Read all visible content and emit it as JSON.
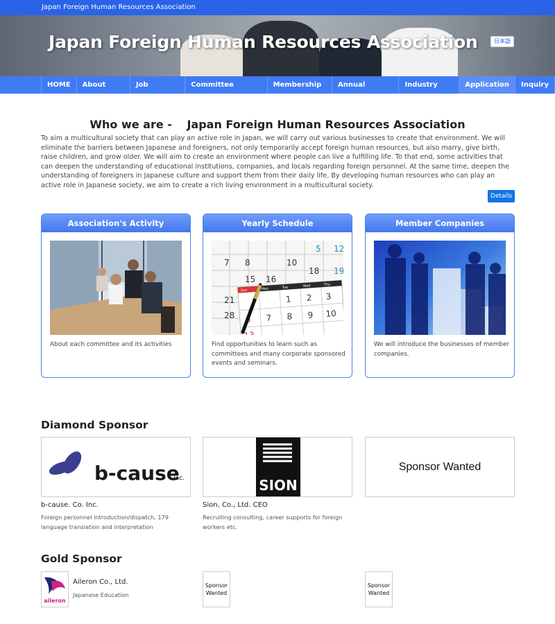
{
  "topbar": {
    "title": "Japan Foreign Human Resources Association"
  },
  "hero": {
    "title": "Japan Foreign Human Resources Association",
    "lang_button": "日本語"
  },
  "nav": {
    "items": [
      "HOME",
      "About JFHRA",
      "Job classified",
      "Committee acitivities",
      "Membership list",
      "Annual Schedule",
      "Industry Event",
      "Application",
      "Inquiry"
    ]
  },
  "intro": {
    "heading": "Who we are -　 Japan Foreign Human Resources Association",
    "text": "To aim a multicultural society that can play an active role in Japan, we will carry out various businesses to create that environment. We will eliminate the barriers between Japanese and foreigners, not only temporarily accept foreign human resources, but also marry, give birth, raise children, and grow older. We will aim to create an environment where people can live a fulfilling life. To that end, some activities that can deepen the understanding of educational institutions, companies, and locals regarding foreign personnel. At the same time, deepen the understanding of foreigners in Japanese culture and support them from their daily life. By developing human resources who can play an active role in Japanese society, we aim to create a rich living environment in a multicultural society.",
    "details_button": "Details"
  },
  "cards": [
    {
      "title": "Association's Activity",
      "text": "About each committee and its activities"
    },
    {
      "title": "Yearly Schedule",
      "text": "Find opportunities to learn such as committees and many corporate sponsored events and seminars."
    },
    {
      "title": "Member Companies",
      "text": "We will introduce the businesses of member companies."
    }
  ],
  "calendar": {
    "back_rows": [
      [
        "",
        "",
        "",
        "",
        "",
        "5",
        "12"
      ],
      [
        "7",
        "8",
        "",
        "10",
        "",
        "",
        "19"
      ],
      [
        "",
        "15",
        "16",
        "",
        "18",
        "",
        ""
      ],
      [
        "21",
        "22",
        "",
        "",
        "",
        "",
        ""
      ],
      [
        "28",
        "29",
        "",
        "",
        "",
        "",
        ""
      ]
    ],
    "front_headers": [
      "Sun",
      "Mon",
      "Tue",
      "Wed",
      "Thu"
    ],
    "front_rows": [
      [
        "",
        "",
        "1",
        "2",
        "3"
      ],
      [
        "6",
        "7",
        "8",
        "9",
        "10"
      ],
      [
        "13",
        "",
        "",
        "",
        ""
      ]
    ]
  },
  "diamond": {
    "heading": "Diamond Sponsor",
    "sponsors": [
      {
        "logo": "b-cause",
        "logo_suffix": "Inc.",
        "name": "b-cause. Co. Inc.",
        "desc": "Foreign personnel introduction/dispatch, 179 language translation and interpretation"
      },
      {
        "logo": "SION",
        "name": "Sion, Co., Ltd. CEO",
        "desc": "Recruiting consulting, career supports for foreign workers etc."
      },
      {
        "logo": "Sponsor Wanted"
      }
    ]
  },
  "gold": {
    "heading": "Gold Sponsor",
    "sponsors": [
      {
        "logo": "aileron",
        "name": "Aileron Co., Ltd.",
        "desc": "Japanese Education"
      },
      {
        "logo": "Sponsor Wanted"
      },
      {
        "logo": "Sponsor Wanted"
      }
    ]
  },
  "colors": {
    "primary": "#2a63e8",
    "nav": "#3f7bf5",
    "details": "#1473e6"
  }
}
